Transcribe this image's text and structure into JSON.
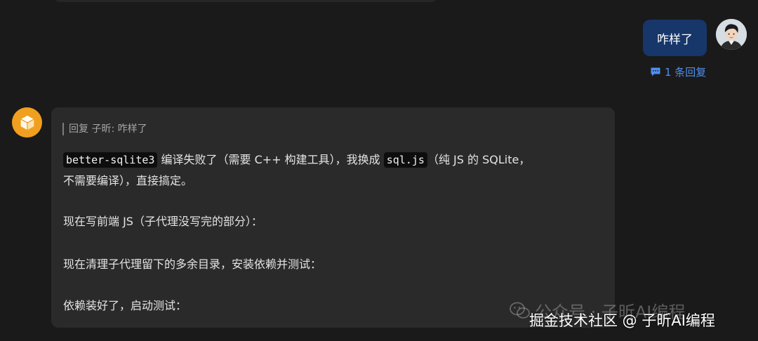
{
  "user_message": {
    "text": "咋样了",
    "reply_count": "1 条回复"
  },
  "bot_message": {
    "quote_prefix": "回复 子昕:",
    "quote_text": "咋样了",
    "p1": {
      "code1": "better-sqlite3",
      "t1": " 编译失败了（需要 C++ 构建工具），我换成 ",
      "code2": "sql.js",
      "t2": "（纯 JS 的 SQLite，"
    },
    "p1_line2": "不需要编译），直接搞定。",
    "p2": "现在写前端 JS（子代理没写完的部分）：",
    "p3": "现在清理子代理留下的多余目录，安装依赖并测试：",
    "p4": "依赖装好了，启动测试："
  },
  "watermark": {
    "official_account": "公众号 · 子昕AI编程",
    "community": "掘金技术社区 @ 子昕AI编程"
  },
  "colors": {
    "background": "#1a1a1a",
    "bot_bubble": "#2a2a2b",
    "user_bubble": "#17366a",
    "link": "#4f8ff0",
    "bot_avatar": "#f0a01e"
  },
  "icons": {
    "reply": "comment-icon",
    "bot": "cube-icon",
    "user": "user-avatar"
  }
}
